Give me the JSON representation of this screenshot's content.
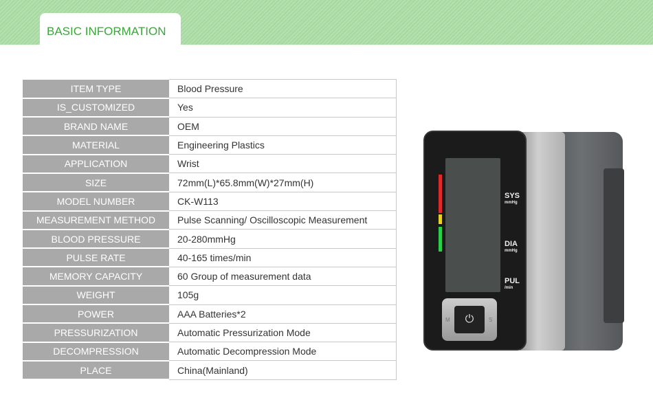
{
  "header": {
    "title": "BASIC INFORMATION",
    "accent": "#3aa63a"
  },
  "specs": [
    {
      "label": "ITEM TYPE",
      "value": "Blood Pressure"
    },
    {
      "label": "IS_CUSTOMIZED",
      "value": "Yes"
    },
    {
      "label": "BRAND NAME",
      "value": "OEM"
    },
    {
      "label": "MATERIAL",
      "value": "Engineering Plastics"
    },
    {
      "label": "APPLICATION",
      "value": "Wrist"
    },
    {
      "label": "SIZE",
      "value": "72mm(L)*65.8mm(W)*27mm(H)"
    },
    {
      "label": "MODEL NUMBER",
      "value": "CK-W113"
    },
    {
      "label": "MEASUREMENT METHOD",
      "value": "Pulse Scanning/ Oscilloscopic Measurement"
    },
    {
      "label": "BLOOD PRESSURE",
      "value": "20-280mmHg"
    },
    {
      "label": "PULSE RATE",
      "value": "40-165 times/min"
    },
    {
      "label": "MEMORY CAPACITY",
      "value": "60 Group of measurement data"
    },
    {
      "label": "WEIGHT",
      "value": "105g"
    },
    {
      "label": "POWER",
      "value": "AAA Batteries*2"
    },
    {
      "label": "PRESSURIZATION",
      "value": "Automatic Pressurization Mode"
    },
    {
      "label": "DECOMPRESSION",
      "value": "Automatic Decompression Mode"
    },
    {
      "label": "PLACE",
      "value": "China(Mainland)"
    }
  ],
  "device": {
    "sys": "SYS",
    "sys_unit": "mmHg",
    "dia": "DIA",
    "dia_unit": "mmHg",
    "pul": "PUL",
    "pul_unit": "/min",
    "m": "M",
    "s": "S",
    "power_icon": "power-icon"
  }
}
